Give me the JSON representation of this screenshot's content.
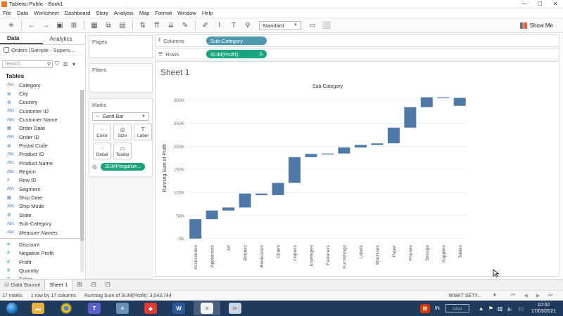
{
  "window": {
    "title": "Tableau Public - Book1"
  },
  "menu": [
    "File",
    "Data",
    "Worksheet",
    "Dashboard",
    "Story",
    "Analysis",
    "Map",
    "Format",
    "Window",
    "Help"
  ],
  "toolbar": {
    "fit_value": "Standard",
    "show_me_label": "Show Me"
  },
  "left_pane": {
    "tabs": [
      "Data",
      "Analytics"
    ],
    "data_source": "Orders (Sample - Supers...",
    "search_placeholder": "Search",
    "tables_heading": "Tables",
    "dimensions": [
      {
        "type": "Abc",
        "name": "Category"
      },
      {
        "type": "geo",
        "name": "City"
      },
      {
        "type": "geo",
        "name": "Country"
      },
      {
        "type": "Abc",
        "name": "Customer ID"
      },
      {
        "type": "Abc",
        "name": "Customer Name"
      },
      {
        "type": "date",
        "name": "Order Date"
      },
      {
        "type": "Abc",
        "name": "Order ID"
      },
      {
        "type": "geo",
        "name": "Postal Code"
      },
      {
        "type": "Abc",
        "name": "Product ID"
      },
      {
        "type": "Abc",
        "name": "Product Name"
      },
      {
        "type": "Abc",
        "name": "Region"
      },
      {
        "type": "num",
        "name": "Row ID"
      },
      {
        "type": "Abc",
        "name": "Segment"
      },
      {
        "type": "date",
        "name": "Ship Date"
      },
      {
        "type": "Abc",
        "name": "Ship Mode"
      },
      {
        "type": "geo",
        "name": "State"
      },
      {
        "type": "Abc",
        "name": "Sub-Category"
      },
      {
        "type": "Abc",
        "name": "Measure Names",
        "italic": true
      }
    ],
    "measures": [
      {
        "type": "num",
        "name": "Discount"
      },
      {
        "type": "num",
        "name": "Negative Profit"
      },
      {
        "type": "num",
        "name": "Profit"
      },
      {
        "type": "num",
        "name": "Quantity"
      },
      {
        "type": "num",
        "name": "Sales"
      }
    ]
  },
  "cards": {
    "pages_title": "Pages",
    "filters_title": "Filters",
    "marks_title": "Marks",
    "mark_type": "Gantt Bar",
    "mark_buttons": [
      "Color",
      "Size",
      "Label",
      "Detail",
      "Tooltip"
    ],
    "size_pill": "SUM(Negative..."
  },
  "shelves": {
    "columns_label": "Columns",
    "columns_pill": "Sub-Category",
    "rows_label": "Rows",
    "rows_pill": "SUM(Profit)"
  },
  "sheet": {
    "title": "Sheet 1"
  },
  "chart_data": {
    "type": "bar",
    "subtype": "waterfall (gantt bar, running sum)",
    "title": "Sub-Category",
    "ylabel": "Running Sum of Profit",
    "xlabel": "",
    "ylim": [
      -5000,
      310000
    ],
    "yticks": [
      0,
      50000,
      100000,
      150000,
      200000,
      250000,
      300000
    ],
    "ytick_labels": [
      "0K",
      "50K",
      "100K",
      "150K",
      "200K",
      "250K",
      "300K"
    ],
    "categories": [
      "Accessories",
      "Appliances",
      "Art",
      "Binders",
      "Bookcases",
      "Chairs",
      "Copiers",
      "Envelopes",
      "Fasteners",
      "Furnishings",
      "Labels",
      "Machines",
      "Paper",
      "Phones",
      "Storage",
      "Supplies",
      "Tables"
    ],
    "running_start": [
      0,
      41937,
      60802,
      67344,
      97565,
      94093,
      120683,
      176401,
      183365,
      184314,
      197373,
      202919,
      206305,
      240359,
      284875,
      306154,
      304965
    ],
    "running_end": [
      41937,
      60802,
      67344,
      97565,
      94093,
      120683,
      176401,
      183365,
      184314,
      197373,
      202919,
      206305,
      240359,
      284875,
      306154,
      304965,
      287567
    ],
    "color": "#4e79a7",
    "grid": true
  },
  "bottom_tabs": {
    "data_source": "Data Source",
    "sheet": "Sheet 1"
  },
  "status": {
    "marks": "17 marks",
    "dims": "1 row by 17 columns",
    "sum": "Running Sum of SUM(Profit): 3,043,744",
    "user": "WIWIT SETY..."
  },
  "taskbar": {
    "lang": "IN",
    "time": "10:32",
    "date": "17/03/2021"
  }
}
